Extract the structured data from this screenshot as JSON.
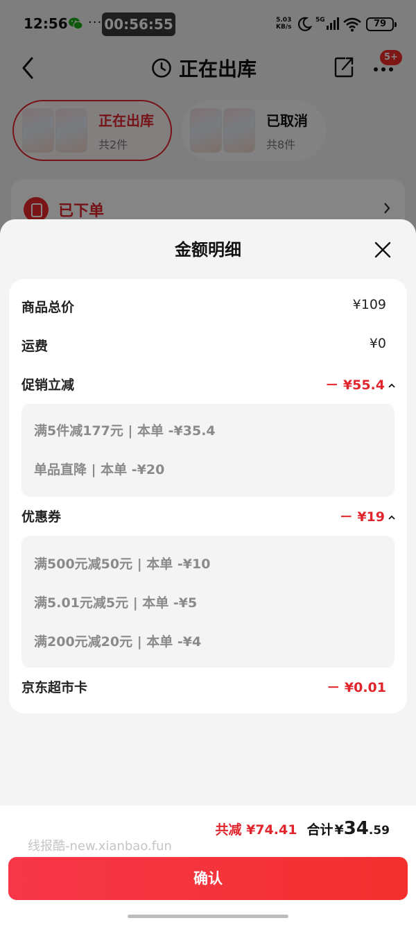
{
  "status_bar": {
    "time": "12:56",
    "dots": "···",
    "timer": "00:56:55",
    "net_speed_value": "5.03",
    "net_speed_unit": "KB/s",
    "signal": "5G",
    "battery": "79"
  },
  "nav": {
    "title": "正在出库",
    "badge": "5+"
  },
  "packages": [
    {
      "status": "正在出库",
      "count": "共2件",
      "active": true
    },
    {
      "status": "已取消",
      "count": "共8件",
      "active": false
    }
  ],
  "order_status": {
    "label": "已下单"
  },
  "sheet": {
    "title": "金额明细",
    "lines": {
      "goods_total": {
        "label": "商品总价",
        "value": "¥109"
      },
      "shipping": {
        "label": "运费",
        "value": "¥0"
      },
      "promotion": {
        "label": "促销立减",
        "value": "－ ¥55.4"
      },
      "coupon": {
        "label": "优惠券",
        "value": "－ ¥19"
      },
      "jd_card": {
        "label": "京东超市卡",
        "value": "－ ¥0.01"
      }
    },
    "promotion_items": [
      "满5件减177元 | 本单 -¥35.4",
      "单品直降 | 本单 -¥20"
    ],
    "coupon_items": [
      "满500元减50元 | 本单 -¥10",
      "满5.01元减5元 | 本单 -¥5",
      "满200元减20元 | 本单 -¥4"
    ]
  },
  "footer": {
    "reduce_label": "共减 ¥74.41",
    "total_label": "合计",
    "total_yen": "¥",
    "total_int": "34",
    "total_dec": ".59",
    "watermark": "线报酷-new.xianbao.fun",
    "confirm_label": "确认"
  },
  "colors": {
    "accent_red": "#e0252c",
    "button_red": "#f3302e",
    "sheet_bg": "#f4f4f4"
  }
}
